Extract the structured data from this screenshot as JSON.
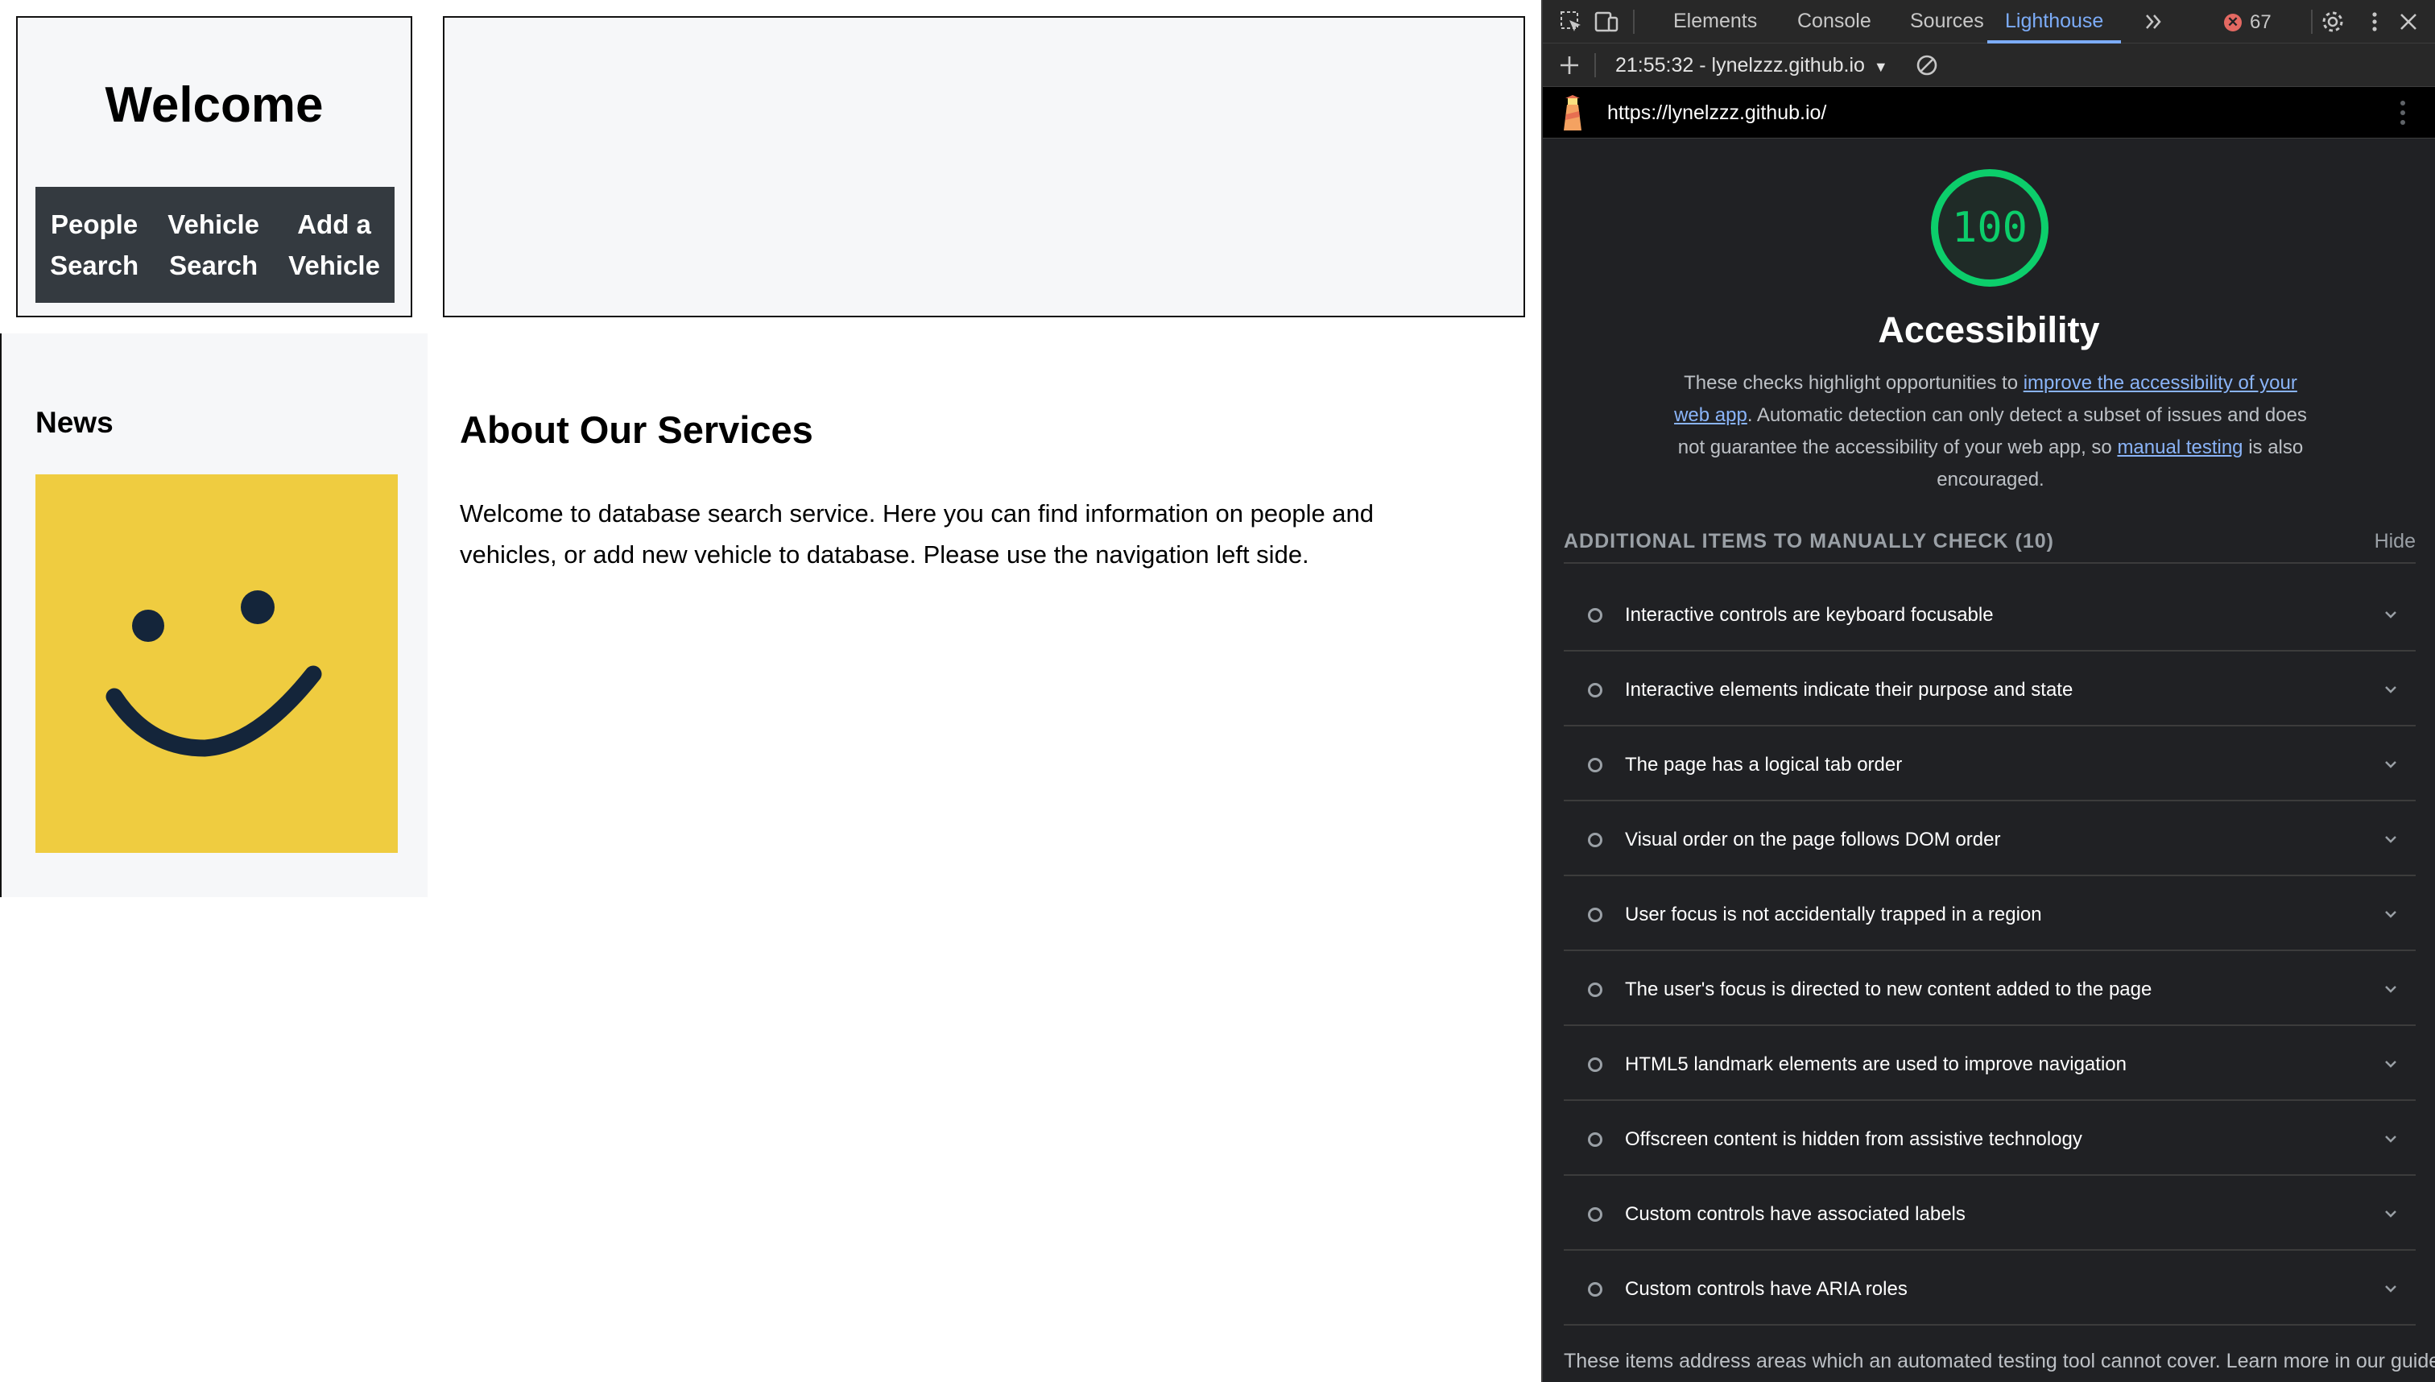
{
  "website": {
    "header_title": "Welcome",
    "nav": [
      {
        "label": "People\nSearch"
      },
      {
        "label": "Vehicle\nSearch"
      },
      {
        "label": "Add a\nVehicle"
      }
    ],
    "sidebar_title": "News",
    "main_title": "About Our Services",
    "main_text": "Welcome to database search service. Here you can find information on people and vehicles, or add new vehicle to database. Please use the navigation left side.",
    "colors": {
      "nav_bg": "#343a40",
      "panel_bg": "#f6f7f9",
      "image_bg": "#efcc40",
      "face": "#14253a"
    }
  },
  "devtools": {
    "tabs": [
      {
        "label": "Elements",
        "active": false
      },
      {
        "label": "Console",
        "active": false
      },
      {
        "label": "Sources",
        "active": false
      },
      {
        "label": "Lighthouse",
        "active": true
      }
    ],
    "more_tabs_icon": "double-chevron-icon",
    "error_count": "67",
    "report_selector": "21:55:32 - lynelzzz.github.io",
    "report_url": "https://lynelzzz.github.io/",
    "score": "100",
    "category_title": "Accessibility",
    "description": {
      "p1": "These checks highlight opportunities to ",
      "link1": "improve the accessibility of your web app",
      "p2": ". Automatic detection can only detect a subset of issues and does not guarantee the accessibility of your web app, so ",
      "link2": "manual testing",
      "p3": " is also encouraged."
    },
    "manual_group": {
      "title": "ADDITIONAL ITEMS TO MANUALLY CHECK (10)",
      "hide_label": "Hide"
    },
    "audits": [
      "Interactive controls are keyboard focusable",
      "Interactive elements indicate their purpose and state",
      "The page has a logical tab order",
      "Visual order on the page follows DOM order",
      "User focus is not accidentally trapped in a region",
      "The user's focus is directed to new content added to the page",
      "HTML5 landmark elements are used to improve navigation",
      "Offscreen content is hidden from assistive technology",
      "Custom controls have associated labels",
      "Custom controls have ARIA roles"
    ],
    "footer_note": "These items address areas which an automated testing tool cannot cover. Learn more in our guide",
    "colors": {
      "score_green": "#0cce6b",
      "link_blue": "#8ab4f8",
      "active_tab": "#7cacf8",
      "error_red": "#e46962"
    }
  }
}
